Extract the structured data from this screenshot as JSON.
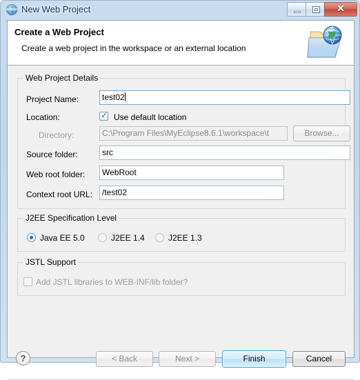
{
  "window": {
    "title": "New Web Project",
    "title_icon": "globe-icon",
    "caption": {
      "minimize": "minimize-icon",
      "maximize": "maximize-icon",
      "close": "✕"
    }
  },
  "header": {
    "title": "Create a Web Project",
    "subtitle": "Create a web project in the workspace or an external location",
    "icon": "web-project-folder-icon"
  },
  "groups": {
    "project_details": {
      "title": "Web Project Details",
      "fields": {
        "project_name": {
          "label": "Project Name:",
          "value": "test02"
        },
        "location": {
          "label": "Location:",
          "checkbox_label": "Use default location",
          "checked": true
        },
        "directory": {
          "label": "Directory:",
          "value": "C:\\Program Files\\MyEclipse8.6.1\\workspace\\t",
          "browse_label": "Browse...",
          "disabled": true
        },
        "source_folder": {
          "label": "Source folder:",
          "value": "src"
        },
        "web_root_folder": {
          "label": "Web root folder:",
          "value": "WebRoot"
        },
        "context_root_url": {
          "label": "Context root URL:",
          "value": "/test02"
        }
      }
    },
    "j2ee_spec": {
      "title": "J2EE Specification Level",
      "options": [
        {
          "label": "Java EE 5.0",
          "selected": true,
          "disabled": false
        },
        {
          "label": "J2EE 1.4",
          "selected": false,
          "disabled": true
        },
        {
          "label": "J2EE 1.3",
          "selected": false,
          "disabled": true
        }
      ]
    },
    "jstl_support": {
      "title": "JSTL Support",
      "checkbox_label": "Add JSTL libraries to WEB-INF/lib folder?",
      "checked": false,
      "disabled": true
    }
  },
  "footer": {
    "help": "?",
    "back": "< Back",
    "next": "Next >",
    "finish": "Finish",
    "cancel": "Cancel"
  },
  "colors": {
    "accent": "#3c9ad4",
    "titlebar": "#c9ddf0",
    "dialog_bg": "#f0f0f0",
    "close_button": "#c04a3c"
  }
}
